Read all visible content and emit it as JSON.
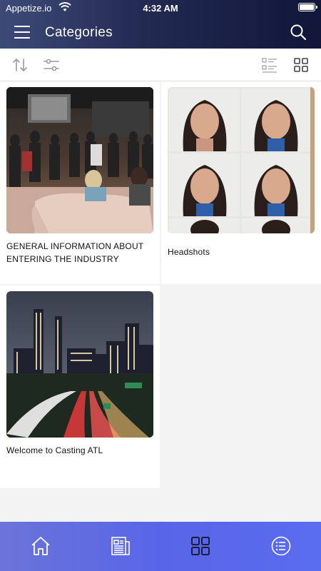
{
  "status_bar": {
    "carrier": "Appetize.io",
    "time": "4:32 AM"
  },
  "header": {
    "title": "Categories"
  },
  "toolbar": {},
  "categories": [
    {
      "caption": "GENERAL INFORMATION ABOUT ENTERING THE INDUSTRY"
    },
    {
      "caption": "Headshots"
    },
    {
      "caption": "Welcome to Casting ATL"
    }
  ],
  "bottom_nav": {
    "items": [
      "home-icon",
      "news-icon",
      "grid-icon",
      "list-icon"
    ]
  },
  "colors": {
    "appbar_start": "#3d4a78",
    "appbar_end": "#11163a",
    "bottom_nav": "#5865e8",
    "active_tab": "#1b1e3a",
    "icon_gray": "#8a8a8a"
  }
}
